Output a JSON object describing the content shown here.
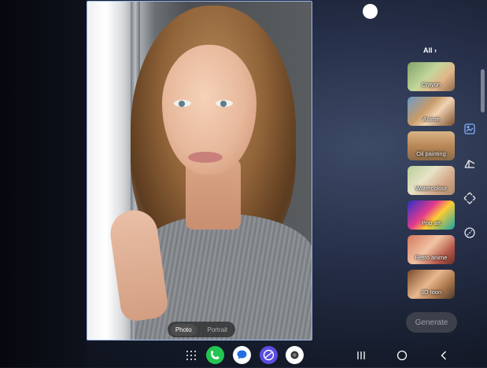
{
  "photo": {
    "mode_options": [
      "Photo",
      "Portrait"
    ],
    "selected_mode": "Photo"
  },
  "styles_panel": {
    "all_label": "All",
    "items": [
      {
        "label": "Crayon"
      },
      {
        "label": "Anime"
      },
      {
        "label": "Oil painting"
      },
      {
        "label": "Watercolour"
      },
      {
        "label": "Pop art"
      },
      {
        "label": "Retro anime"
      },
      {
        "label": "3D toon"
      }
    ]
  },
  "tools": [
    {
      "icon": "image-style-icon"
    },
    {
      "icon": "perspective-icon"
    },
    {
      "icon": "resize-icon"
    },
    {
      "icon": "eraser-icon"
    }
  ],
  "generate_label": "Generate",
  "taskbar": {
    "apps": [
      {
        "icon": "apps-grid-icon"
      },
      {
        "icon": "phone-icon",
        "color": "#23c552"
      },
      {
        "icon": "messages-icon",
        "color": "#ffffff"
      },
      {
        "icon": "internet-icon",
        "color": "#5a4de0"
      },
      {
        "icon": "camera-icon",
        "color": "#ffffff"
      }
    ],
    "nav": [
      {
        "icon": "recents-icon"
      },
      {
        "icon": "home-icon"
      },
      {
        "icon": "back-icon"
      }
    ]
  },
  "colors": {
    "accent": "#9fb8e8",
    "generate_bg": "#3c404a"
  }
}
